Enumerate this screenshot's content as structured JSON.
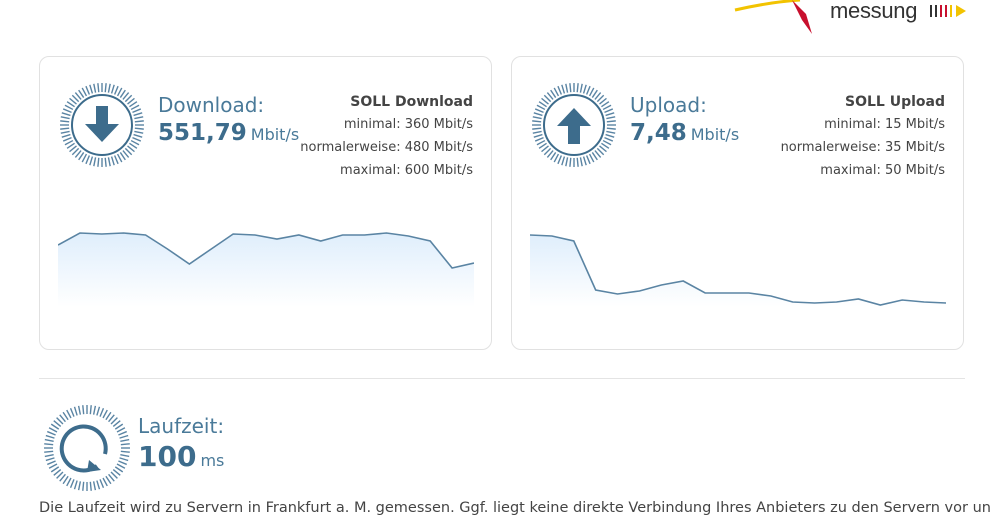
{
  "logo": {
    "text": "messung",
    "colors": {
      "red": "#c8102e",
      "yellow": "#f2c300",
      "dark": "#333333"
    }
  },
  "download": {
    "label": "Download:",
    "value": "551,79",
    "unit": "Mbit/s",
    "icon": "arrow-down-icon",
    "soll": {
      "title": "SOLL Download",
      "minimal": "minimal: 360 Mbit/s",
      "normal": "normalerweise: 480 Mbit/s",
      "maximal": "maximal: 600 Mbit/s"
    },
    "series": [
      62,
      74,
      73,
      74,
      72,
      58,
      43,
      58,
      73,
      72,
      68,
      72,
      66,
      72,
      72,
      74,
      71,
      66,
      39,
      44
    ]
  },
  "upload": {
    "label": "Upload:",
    "value": "7,48",
    "unit": "Mbit/s",
    "icon": "arrow-up-icon",
    "soll": {
      "title": "SOLL Upload",
      "minimal": "minimal: 15 Mbit/s",
      "normal": "normalerweise: 35 Mbit/s",
      "maximal": "maximal: 50 Mbit/s"
    },
    "series": [
      72,
      71,
      66,
      17,
      13,
      16,
      22,
      26,
      14,
      14,
      14,
      11,
      5,
      4,
      5,
      8,
      2,
      7,
      5,
      4
    ]
  },
  "latency": {
    "label": "Laufzeit:",
    "value": "100",
    "unit": "ms",
    "icon": "refresh-icon"
  },
  "note": "Die Laufzeit wird zu Servern in Frankfurt a. M. gemessen. Ggf. liegt keine direkte Verbindung Ihres Anbieters zu den Servern vor und es",
  "colors": {
    "accent": "#3d6c8c",
    "line": "#5a84a3",
    "fill": "#dfeefc",
    "border": "#e1e1e1"
  }
}
